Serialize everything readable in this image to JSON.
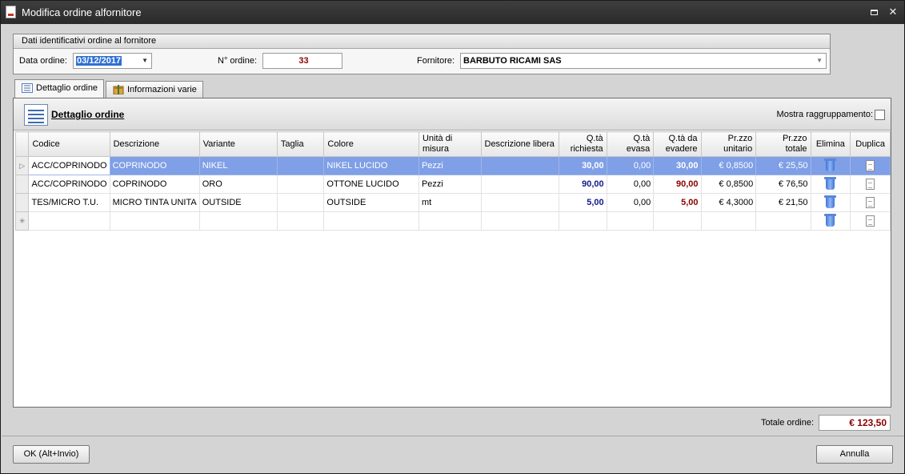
{
  "window": {
    "title": "Modifica ordine alfornitore"
  },
  "header": {
    "title": "Dati identificativi ordine al fornitore",
    "data_label": "Data ordine:",
    "data_value": "03/12/2017",
    "num_label": "N° ordine:",
    "num_value": "33",
    "forn_label": "Fornitore:",
    "forn_value": "BARBUTO RICAMI SAS"
  },
  "tabs": [
    {
      "label": "Dettaglio ordine",
      "icon": "list-icon"
    },
    {
      "label": "Informazioni varie",
      "icon": "box-icon"
    }
  ],
  "panel": {
    "title": "Dettaglio ordine",
    "group_label": "Mostra raggruppamento:"
  },
  "grid": {
    "columns": [
      {
        "label": "Codice"
      },
      {
        "label": "Descrizione"
      },
      {
        "label": "Variante"
      },
      {
        "label": "Taglia"
      },
      {
        "label": "Colore"
      },
      {
        "label": "Unità di misura"
      },
      {
        "label": "Descrizione libera"
      },
      {
        "label": "Q.tà richiesta"
      },
      {
        "label": "Q.tà evasa"
      },
      {
        "label": "Q.tà da evadere"
      },
      {
        "label": "Pr.zzo unitario"
      },
      {
        "label": "Pr.zzo totale"
      },
      {
        "label": "Elimina"
      },
      {
        "label": "Duplica"
      }
    ],
    "rows": [
      {
        "codice": "ACC/COPRINODO",
        "descrizione": "COPRINODO",
        "variante": "NIKEL",
        "taglia": "",
        "colore": "NIKEL LUCIDO",
        "unita": "Pezzi",
        "desc_libera": "",
        "qta_richiesta": "30,00",
        "qta_evasa": "0,00",
        "qta_da_evadere": "30,00",
        "prezzo_unitario": "€ 0,8500",
        "prezzo_totale": "€ 25,50"
      },
      {
        "codice": "ACC/COPRINODO",
        "descrizione": "COPRINODO",
        "variante": "ORO",
        "taglia": "",
        "colore": "OTTONE LUCIDO",
        "unita": "Pezzi",
        "desc_libera": "",
        "qta_richiesta": "90,00",
        "qta_evasa": "0,00",
        "qta_da_evadere": "90,00",
        "prezzo_unitario": "€ 0,8500",
        "prezzo_totale": "€ 76,50"
      },
      {
        "codice": "TES/MICRO T.U.",
        "descrizione": "MICRO TINTA UNITA",
        "variante": "OUTSIDE",
        "taglia": "",
        "colore": "OUTSIDE",
        "unita": "mt",
        "desc_libera": "",
        "qta_richiesta": "5,00",
        "qta_evasa": "0,00",
        "qta_da_evadere": "5,00",
        "prezzo_unitario": "€ 4,3000",
        "prezzo_totale": "€ 21,50"
      }
    ]
  },
  "totals": {
    "label": "Totale ordine:",
    "value": "€ 123,50"
  },
  "buttons": {
    "ok": "OK (Alt+Invio)",
    "cancel": "Annulla"
  },
  "colors": {
    "selection": "#7f9fe6",
    "qty_blue": "#101a8a",
    "qty_red": "#8b0000",
    "title_bar": "#2f2f2f"
  }
}
